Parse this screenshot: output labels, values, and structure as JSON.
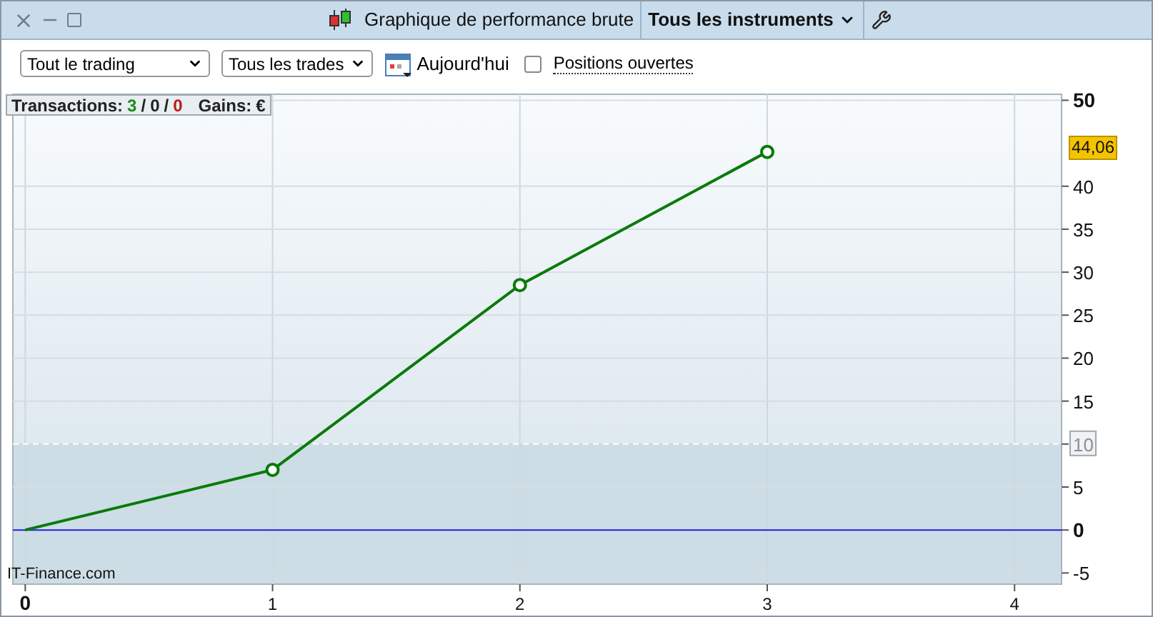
{
  "window": {
    "title": "Graphique de performance brute",
    "instrument_menu": "Tous les instruments"
  },
  "toolbar": {
    "scope_select": "Tout le trading",
    "trades_select": "Tous les trades",
    "date_label": "Aujourd'hui",
    "open_positions": {
      "label": "Positions ouvertes",
      "checked": false
    }
  },
  "summary": {
    "label": "Transactions:",
    "wins": "3",
    "neutral": "0",
    "losses": "0",
    "separator": "/",
    "gains_label": "Gains:",
    "currency": "€"
  },
  "branding": "IT-Finance.com",
  "chart": {
    "current_value": "44,06",
    "chart_data": {
      "type": "line",
      "x": [
        0,
        1,
        2,
        3
      ],
      "series": [
        {
          "color": "#0a7a0a",
          "values": [
            0,
            7,
            28.5,
            44
          ]
        }
      ],
      "xlim": [
        -0.05,
        4.19
      ],
      "ylim": [
        -6.3,
        50.7
      ],
      "xticks": [
        0,
        1,
        2,
        3,
        4
      ],
      "yticks": [
        -5,
        0,
        5,
        {
          "value": 10,
          "label": "10"
        },
        15,
        20,
        25,
        30,
        35,
        40,
        50
      ],
      "grid": true,
      "ref_lines": [
        {
          "axis": "y",
          "value": 0,
          "color": "#2020e0"
        },
        {
          "axis": "y",
          "value": 10,
          "color": "#ffffff"
        }
      ]
    }
  }
}
